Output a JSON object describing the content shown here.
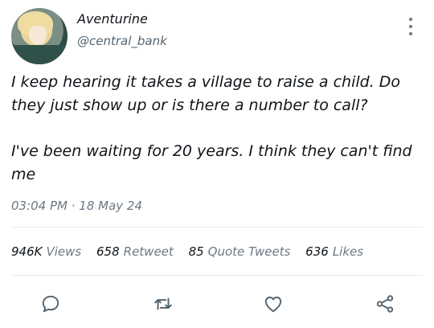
{
  "author": {
    "display_name": "Aventurine",
    "handle": "@central_bank",
    "avatar_icon": "avatar"
  },
  "tweet": {
    "paragraphs": [
      "I keep hearing it takes a village to raise a child. Do they just show up or is there a number to call?",
      "I've been waiting for 20 years. I think they can't find me"
    ],
    "timestamp": "03:04 PM · 18 May 24"
  },
  "stats": {
    "views_count": "946K",
    "views_label": "Views",
    "retweet_count": "658",
    "retweet_label": "Retweet",
    "quote_count": "85",
    "quote_label": "Quote Tweets",
    "likes_count": "636",
    "likes_label": "Likes"
  },
  "actions": [
    "reply-icon",
    "retweet-icon",
    "like-icon",
    "share-icon"
  ],
  "colors": {
    "text": "#0f1419",
    "muted": "#6b7885",
    "divider": "#e6ecf0"
  }
}
